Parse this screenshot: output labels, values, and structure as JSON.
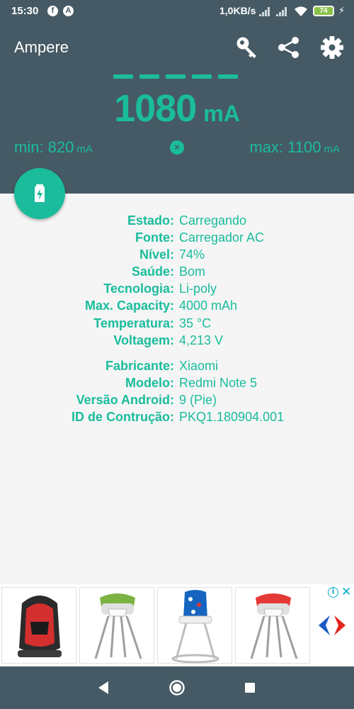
{
  "status_bar": {
    "time": "15:30",
    "app_icon_1": "f",
    "app_icon_2": "A",
    "net_speed": "1,0KB/s",
    "battery": "74"
  },
  "header": {
    "title": "Ampere",
    "icons": [
      "key-icon",
      "share-icon",
      "settings-icon"
    ]
  },
  "meter": {
    "value": "1080",
    "unit": "mA",
    "min_label": "min: 820",
    "min_unit": "mA",
    "max_label": "max: 1100",
    "max_unit": "mA",
    "reset_symbol": "×"
  },
  "battery_info": [
    {
      "label": "Estado:",
      "value": "Carregando"
    },
    {
      "label": "Fonte:",
      "value": "Carregador AC"
    },
    {
      "label": "Nível:",
      "value": "74%"
    },
    {
      "label": "Saúde:",
      "value": "Bom"
    },
    {
      "label": "Tecnologia:",
      "value": "Li-poly"
    },
    {
      "label": "Max. Capacity:",
      "value": "4000 mAh"
    },
    {
      "label": "Temperatura:",
      "value": "35 °C"
    },
    {
      "label": "Voltagem:",
      "value": "4,213 V"
    }
  ],
  "device_info": [
    {
      "label": "Fabricante:",
      "value": "Xiaomi"
    },
    {
      "label": "Modelo:",
      "value": "Redmi Note 5"
    },
    {
      "label": "Versão Android:",
      "value": "9 (Pie)"
    },
    {
      "label": "ID de Contrução:",
      "value": "PKQ1.180904.001"
    }
  ],
  "ad": {
    "info_symbol": "i",
    "close_symbol": "✕",
    "products": [
      "car-seat-image",
      "high-chair-green-image",
      "high-chair-pattern-image",
      "high-chair-red-image"
    ]
  },
  "colors": {
    "primary": "#455a64",
    "accent": "#1abc9c",
    "background": "#f5f5f5"
  }
}
